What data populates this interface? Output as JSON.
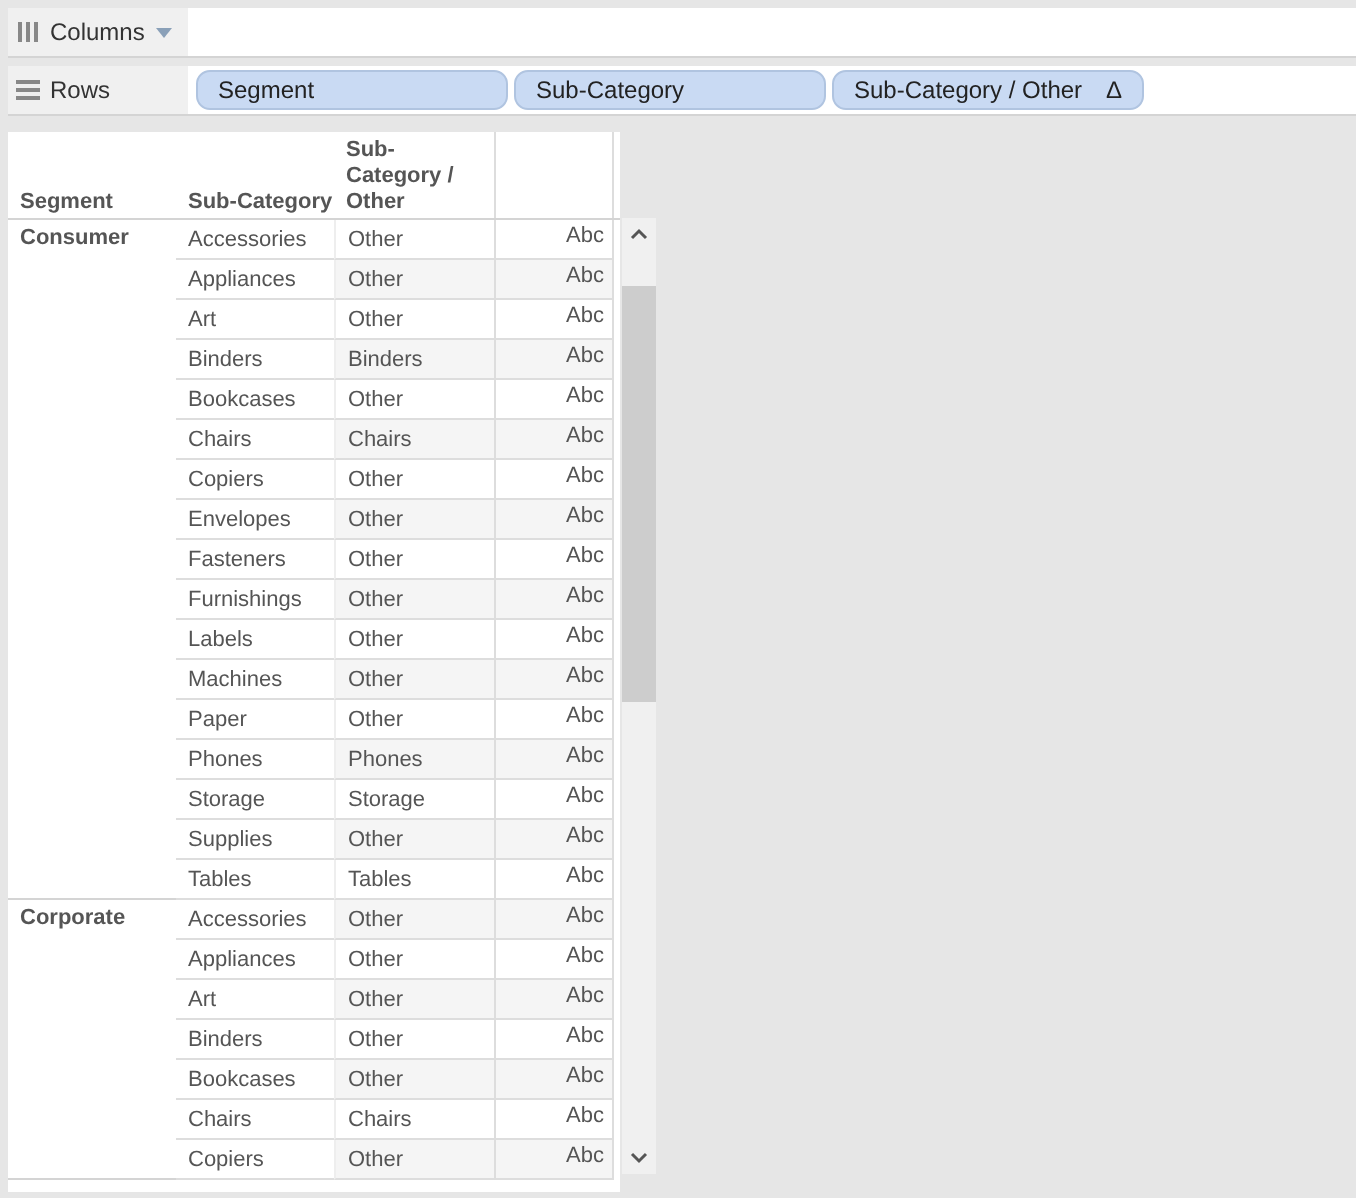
{
  "columns_shelf": {
    "label": "Columns"
  },
  "rows_shelf": {
    "label": "Rows",
    "pills": [
      {
        "label": "Segment"
      },
      {
        "label": "Sub-Category"
      },
      {
        "label": "Sub-Category / Other",
        "delta": "Δ"
      }
    ]
  },
  "table": {
    "columns": [
      "Segment",
      "Sub-Category",
      "Sub-Category / Other"
    ],
    "groups": [
      {
        "segment": "Consumer",
        "rows": [
          [
            "Accessories",
            "Other",
            "Abc"
          ],
          [
            "Appliances",
            "Other",
            "Abc"
          ],
          [
            "Art",
            "Other",
            "Abc"
          ],
          [
            "Binders",
            "Binders",
            "Abc"
          ],
          [
            "Bookcases",
            "Other",
            "Abc"
          ],
          [
            "Chairs",
            "Chairs",
            "Abc"
          ],
          [
            "Copiers",
            "Other",
            "Abc"
          ],
          [
            "Envelopes",
            "Other",
            "Abc"
          ],
          [
            "Fasteners",
            "Other",
            "Abc"
          ],
          [
            "Furnishings",
            "Other",
            "Abc"
          ],
          [
            "Labels",
            "Other",
            "Abc"
          ],
          [
            "Machines",
            "Other",
            "Abc"
          ],
          [
            "Paper",
            "Other",
            "Abc"
          ],
          [
            "Phones",
            "Phones",
            "Abc"
          ],
          [
            "Storage",
            "Storage",
            "Abc"
          ],
          [
            "Supplies",
            "Other",
            "Abc"
          ],
          [
            "Tables",
            "Tables",
            "Abc"
          ]
        ]
      },
      {
        "segment": "Corporate",
        "rows": [
          [
            "Accessories",
            "Other",
            "Abc"
          ],
          [
            "Appliances",
            "Other",
            "Abc"
          ],
          [
            "Art",
            "Other",
            "Abc"
          ],
          [
            "Binders",
            "Other",
            "Abc"
          ],
          [
            "Bookcases",
            "Other",
            "Abc"
          ],
          [
            "Chairs",
            "Chairs",
            "Abc"
          ],
          [
            "Copiers",
            "Other",
            "Abc"
          ]
        ]
      }
    ]
  }
}
